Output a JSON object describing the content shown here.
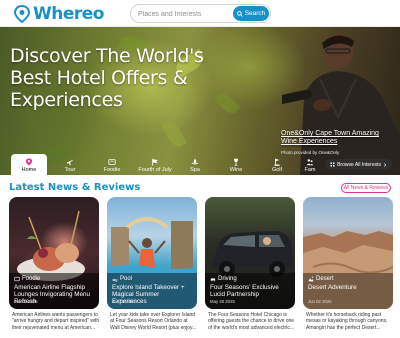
{
  "brand": {
    "name": "Whereo",
    "color": "#1a90c8"
  },
  "search": {
    "placeholder": "Places and Interests",
    "button_label": "Search"
  },
  "hero": {
    "title": "Discover The World's Best Hotel Offers & Experiences",
    "caption": "One&Only Cape Town Amazing Wine Experiences",
    "credit": "Photo provided by One&Only"
  },
  "categories": [
    {
      "label": "Home",
      "icon": "pin-icon",
      "active": true
    },
    {
      "label": "Tour",
      "icon": "plane-icon"
    },
    {
      "label": "Foodie",
      "icon": "fork-icon"
    },
    {
      "label": "Fourth of July",
      "icon": "flag-icon"
    },
    {
      "label": "Spa",
      "icon": "spa-icon"
    },
    {
      "label": "Wine",
      "icon": "glass-icon"
    },
    {
      "label": "Golf",
      "icon": "golf-icon"
    },
    {
      "label": "Fam",
      "icon": "family-icon"
    }
  ],
  "browse_label": "Browse All Interests",
  "news": {
    "heading": "Latest News & Reviews",
    "all_label": "All News & Reviews",
    "accent": "#e4368e",
    "cards": [
      {
        "category": "Foodie",
        "icon": "fork-icon",
        "headline": "American Airline Flagship Lounges Invigorating Menu Refresh",
        "date": "Jun 02 2025",
        "desc": "American Airlines wants passengers to \"arrive hungry and depart inspired\" with their rejuvenated menu at American..."
      },
      {
        "category": "Pool",
        "icon": "pool-icon",
        "headline": "Explore Island Takeover + Magical Summer Experiences",
        "date": "Jun 02 2025",
        "desc": "Let your kids take over Explorer Island at Four Seasons Resort Orlando at Walt Disney World Resort (plus enjoy..."
      },
      {
        "category": "Driving",
        "icon": "car-icon",
        "headline": "Four Seasons' Exclusive Lucid Partnership",
        "date": "May 30 2025",
        "desc": "The Four Seasons Hotel Chicago is offering guests the chance to drive one of the world's most advanced electric..."
      },
      {
        "category": "Desert",
        "icon": "desert-icon",
        "headline": "Desert Adventure",
        "date": "Jun 02 2025",
        "desc": "Whether it's horseback riding past mesas or kayaking through canyons, Amangiri has the perfect Desert..."
      }
    ]
  }
}
